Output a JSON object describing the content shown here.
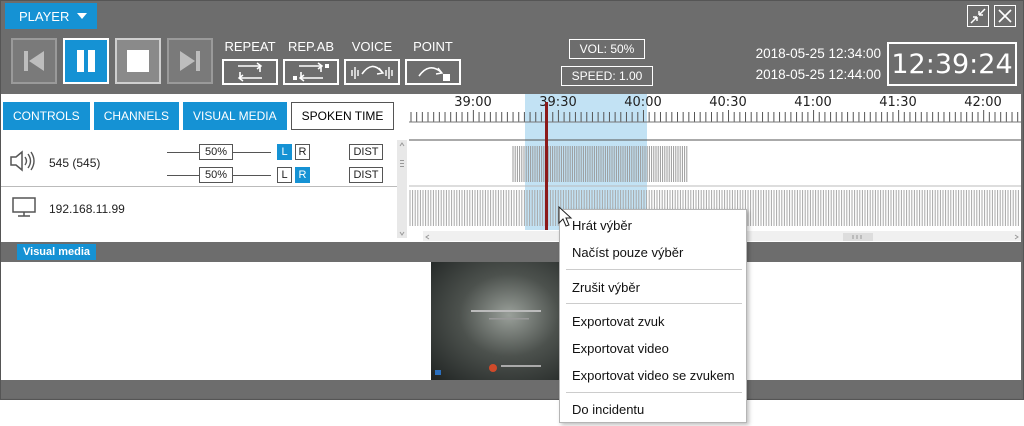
{
  "titlebar": {
    "player_label": "PLAYER",
    "restore_icon": "collapse-arrows-icon",
    "close_icon": "close-icon"
  },
  "toolbar": {
    "transport": [
      "skip-back-icon",
      "pause-icon",
      "stop-icon",
      "skip-forward-icon"
    ],
    "modes": [
      {
        "label": "REPEAT",
        "icon": "repeat-icon"
      },
      {
        "label": "REP.AB",
        "icon": "repeat-ab-icon"
      },
      {
        "label": "VOICE",
        "icon": "voice-icon"
      },
      {
        "label": "POINT",
        "icon": "point-icon"
      }
    ],
    "volume": "VOL: 50%",
    "speed": "SPEED: 1.00",
    "date_from": "2018-05-25 12:34:00",
    "date_to": "2018-05-25 12:44:00",
    "clock": "12:39:24"
  },
  "tabs": [
    {
      "label": "CONTROLS",
      "active": true
    },
    {
      "label": "CHANNELS",
      "active": true
    },
    {
      "label": "VISUAL MEDIA",
      "active": true
    },
    {
      "label": "SPOKEN TIME",
      "active": false
    }
  ],
  "channels": [
    {
      "icon": "speaker-icon",
      "name": "545 (545)",
      "levels": [
        "50%",
        "50%"
      ],
      "lr_first": [
        "L",
        "R"
      ],
      "lr_second": [
        "L",
        "R"
      ],
      "dist": [
        "DIST",
        "DIST"
      ]
    },
    {
      "icon": "monitor-icon",
      "name": "192.168.11.99"
    }
  ],
  "timeline": {
    "ticks": [
      "39:00",
      "39:30",
      "40:00",
      "40:30",
      "41:00",
      "41:30",
      "42:00"
    ],
    "selection_start": "39:20",
    "selection_end": "40:00",
    "cursor": "39:24"
  },
  "visual_media": {
    "label": "Visual media"
  },
  "context_menu": {
    "items": [
      [
        "Hrát výběr",
        "Načíst pouze výběr"
      ],
      [
        "Zrušit výběr"
      ],
      [
        "Exportovat zvuk",
        "Exportovat video",
        "Exportovat video se zvukem"
      ],
      [
        "Do incidentu"
      ]
    ]
  },
  "colors": {
    "accent": "#1592d4",
    "toolbar": "#6d6d6d",
    "selection": "#a6d4ee",
    "cursor": "#8b1a1a"
  }
}
